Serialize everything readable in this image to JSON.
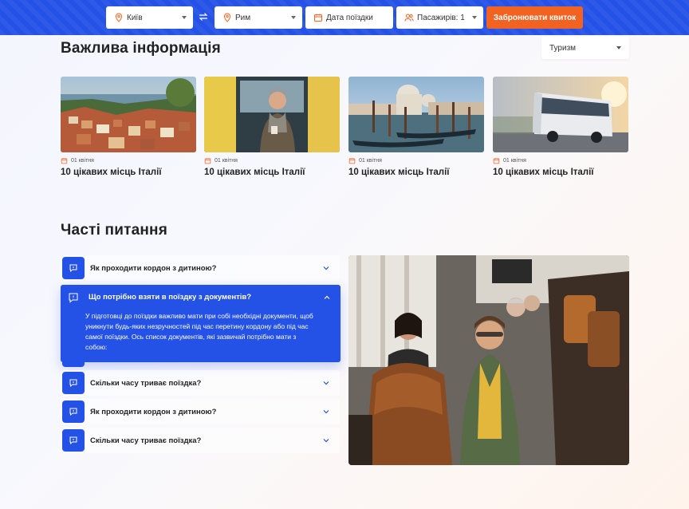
{
  "search": {
    "from": "Київ",
    "to": "Рим",
    "date_placeholder": "Дата поїздки",
    "passengers": "Пасажирів: 1",
    "book_button": "Забронювати квиток"
  },
  "info": {
    "heading": "Важлива інформація",
    "filter": "Туризм",
    "cards": [
      {
        "date": "01 квітня",
        "title": "10 цікавих місць Італії",
        "image": "coastal-town-photo"
      },
      {
        "date": "01 квітня",
        "title": "10 цікавих місць Італії",
        "image": "traveler-on-bus-photo"
      },
      {
        "date": "01 квітня",
        "title": "10 цікавих місць Італії",
        "image": "venice-canal-photo"
      },
      {
        "date": "01 квітня",
        "title": "10 цікавих місць Італії",
        "image": "tour-bus-photo"
      }
    ]
  },
  "faq": {
    "heading": "Часті питання",
    "items": [
      {
        "question": "Як проходити кордон з дитиною?"
      },
      {
        "question": "Що потрібно взяти в поїздку з документів?",
        "expanded": true,
        "answer": "У підготовці до поїздки важливо мати при собі необхідні документи, щоб уникнути будь-яких незручностей під час перетину кордону або під час самої поїздки. Ось список документів, які зазвичай потрібно мати з собою:"
      },
      {
        "question": "Скільки часу триває поїздка?"
      },
      {
        "question": "Як проходити кордон з дитиною?"
      },
      {
        "question": "Скільки часу триває поїздка?"
      }
    ],
    "image": "bus-passengers-photo"
  },
  "colors": {
    "primary": "#2451e6",
    "accent": "#f26322"
  }
}
